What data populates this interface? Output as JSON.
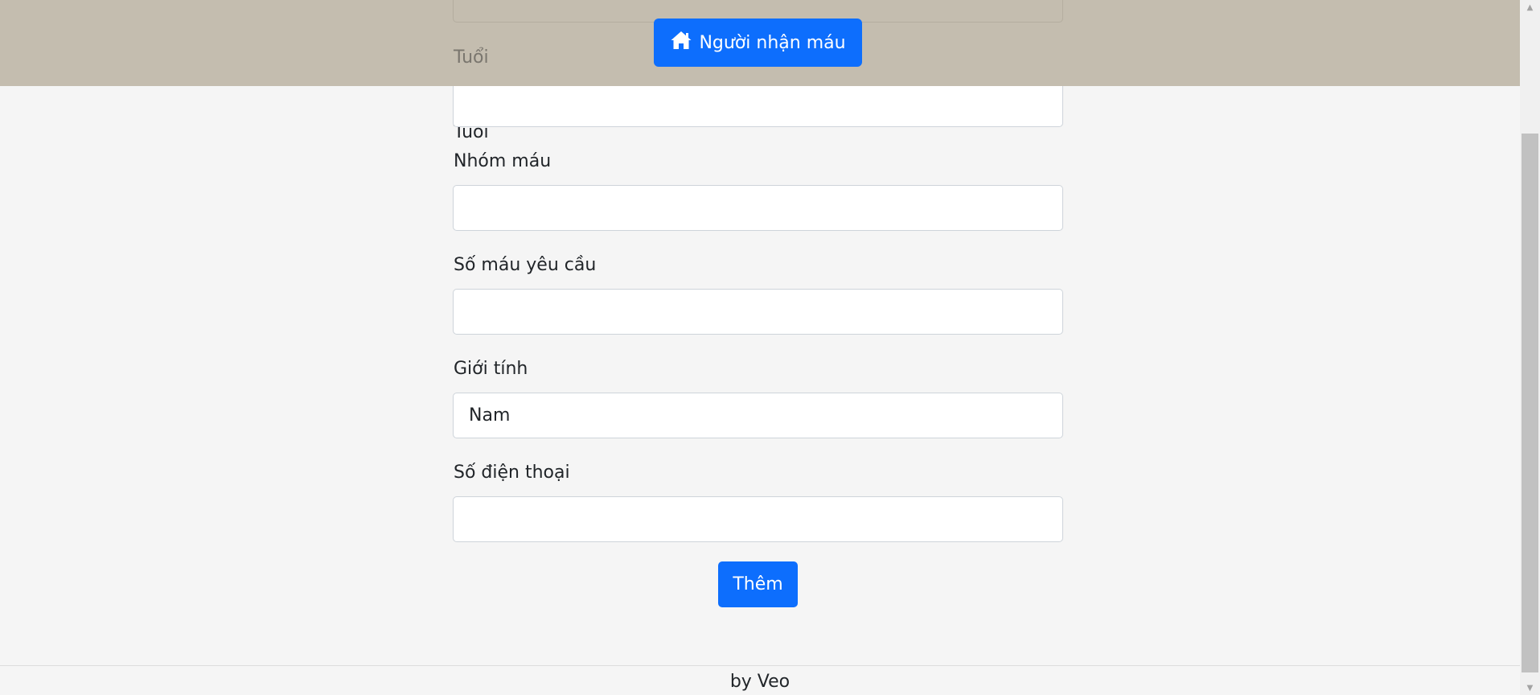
{
  "header": {
    "nav_button_label": "Người nhận máu",
    "nav_button_icon": "home-icon",
    "accent_color": "#0d6efd"
  },
  "form": {
    "fields": [
      {
        "label": "Tuổi",
        "value": ""
      },
      {
        "label": "Nhóm máu",
        "value": ""
      },
      {
        "label": "Số máu yêu cầu",
        "value": ""
      },
      {
        "label": "Giới tính",
        "value": "Nam"
      },
      {
        "label": "Số điện thoại",
        "value": ""
      }
    ],
    "submit_label": "Thêm"
  },
  "footer": {
    "text": "by Veo"
  }
}
